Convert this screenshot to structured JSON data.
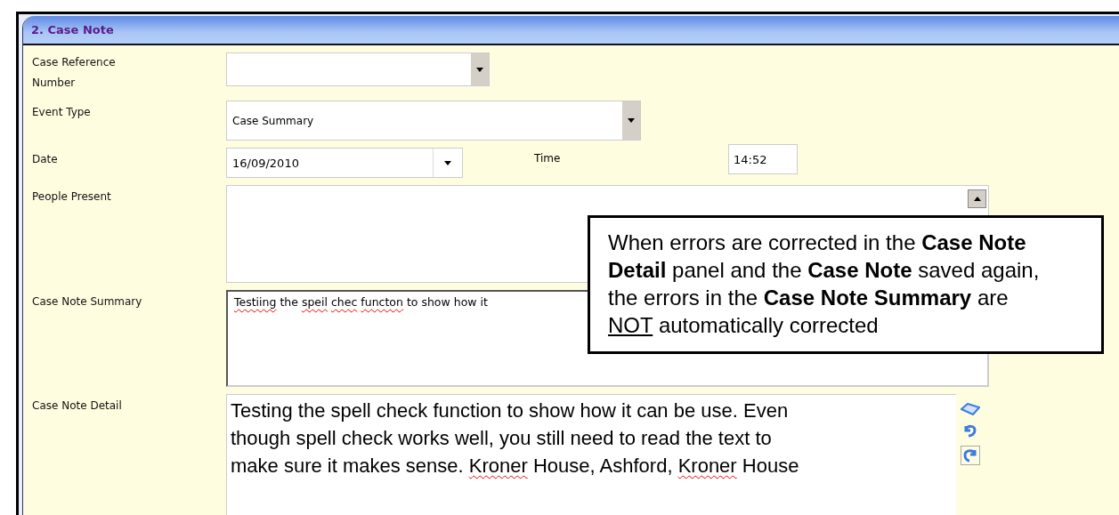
{
  "panel": {
    "title": "2. Case Note"
  },
  "fields": [
    {
      "kind": "combo",
      "label": "Case Reference Number"
    },
    {
      "kind": "combo",
      "label": "Event Type",
      "value": "Case Summary"
    },
    {
      "kind": "date",
      "label": "Date",
      "value": "16/09/2010",
      "time_label": "Time",
      "time_value": "14:52"
    },
    {
      "kind": "memo",
      "label": "People Present"
    },
    {
      "kind": "summary",
      "label": "Case Note Summary",
      "segments": [
        {
          "text": "Testiing",
          "misspelled": true
        },
        {
          "text": "the",
          "misspelled": false
        },
        {
          "text": "speil",
          "misspelled": true
        },
        {
          "text": "chec",
          "misspelled": true
        },
        {
          "text": "functon",
          "misspelled": true
        },
        {
          "text": "to show how it",
          "misspelled": false
        }
      ]
    },
    {
      "kind": "detail",
      "label": "Case Note Detail",
      "lines": [
        [
          {
            "text": "Testing the spell check function to show how it can be use.  Even",
            "misspelled": false
          }
        ],
        [
          {
            "text": "though spell check works well, you still need to read the text to",
            "misspelled": false
          }
        ],
        [
          {
            "text": "make sure it makes sense.",
            "misspelled": false
          },
          {
            "text": "Kroner",
            "misspelled": true
          },
          {
            "text": "House, Ashford,",
            "misspelled": false
          },
          {
            "text": "Kroner",
            "misspelled": true
          },
          {
            "text": "House",
            "misspelled": false
          }
        ]
      ]
    }
  ],
  "callout": {
    "segments": [
      {
        "text": "When errors are corrected in the",
        "kind": "plain"
      },
      {
        "text": "Case Note Detail",
        "kind": "bold"
      },
      {
        "text": "panel and the",
        "kind": "plain"
      },
      {
        "text": "Case Note",
        "kind": "bold"
      },
      {
        "text": "saved again, the errors in the",
        "kind": "plain"
      },
      {
        "text": "Case Note Summary",
        "kind": "bold"
      },
      {
        "text": "are",
        "kind": "plain"
      },
      {
        "text": "NOT",
        "kind": "underline"
      },
      {
        "text": "automatically corrected",
        "kind": "plain"
      }
    ]
  }
}
